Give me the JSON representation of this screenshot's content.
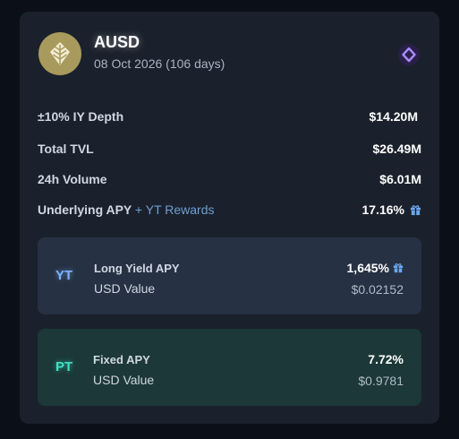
{
  "header": {
    "token": "AUSD",
    "maturity": "08 Oct 2026 (106 days)",
    "logo_icon": "leaf-emblem-icon",
    "chain_icon": "network-ring-icon"
  },
  "stats": {
    "depth_label": "±10% IY Depth",
    "depth_value": "$14.20M",
    "tvl_label": "Total TVL",
    "tvl_value": "$26.49M",
    "volume_label": "24h Volume",
    "volume_value": "$6.01M",
    "apy_label": "Underlying APY",
    "apy_plus": "+ YT Rewards",
    "apy_value": "17.16%",
    "apy_icon": "gift-icon"
  },
  "yt": {
    "badge": "YT",
    "label": "Long Yield APY",
    "sub_label": "USD Value",
    "value": "1,645%",
    "usd": "$0.02152",
    "icon": "gift-icon"
  },
  "pt": {
    "badge": "PT",
    "label": "Fixed APY",
    "sub_label": "USD Value",
    "value": "7.72%",
    "usd": "$0.9781"
  },
  "colors": {
    "card_bg": "#1b212c",
    "yt_panel": "#263143",
    "pt_panel": "#1c3838",
    "yt_accent": "#7fb1ff",
    "pt_accent": "#3fe0c4",
    "logo_gold": "#a89a5c",
    "chain_purple": "#8b5cf6",
    "gift_blue": "#6aa8f0"
  }
}
